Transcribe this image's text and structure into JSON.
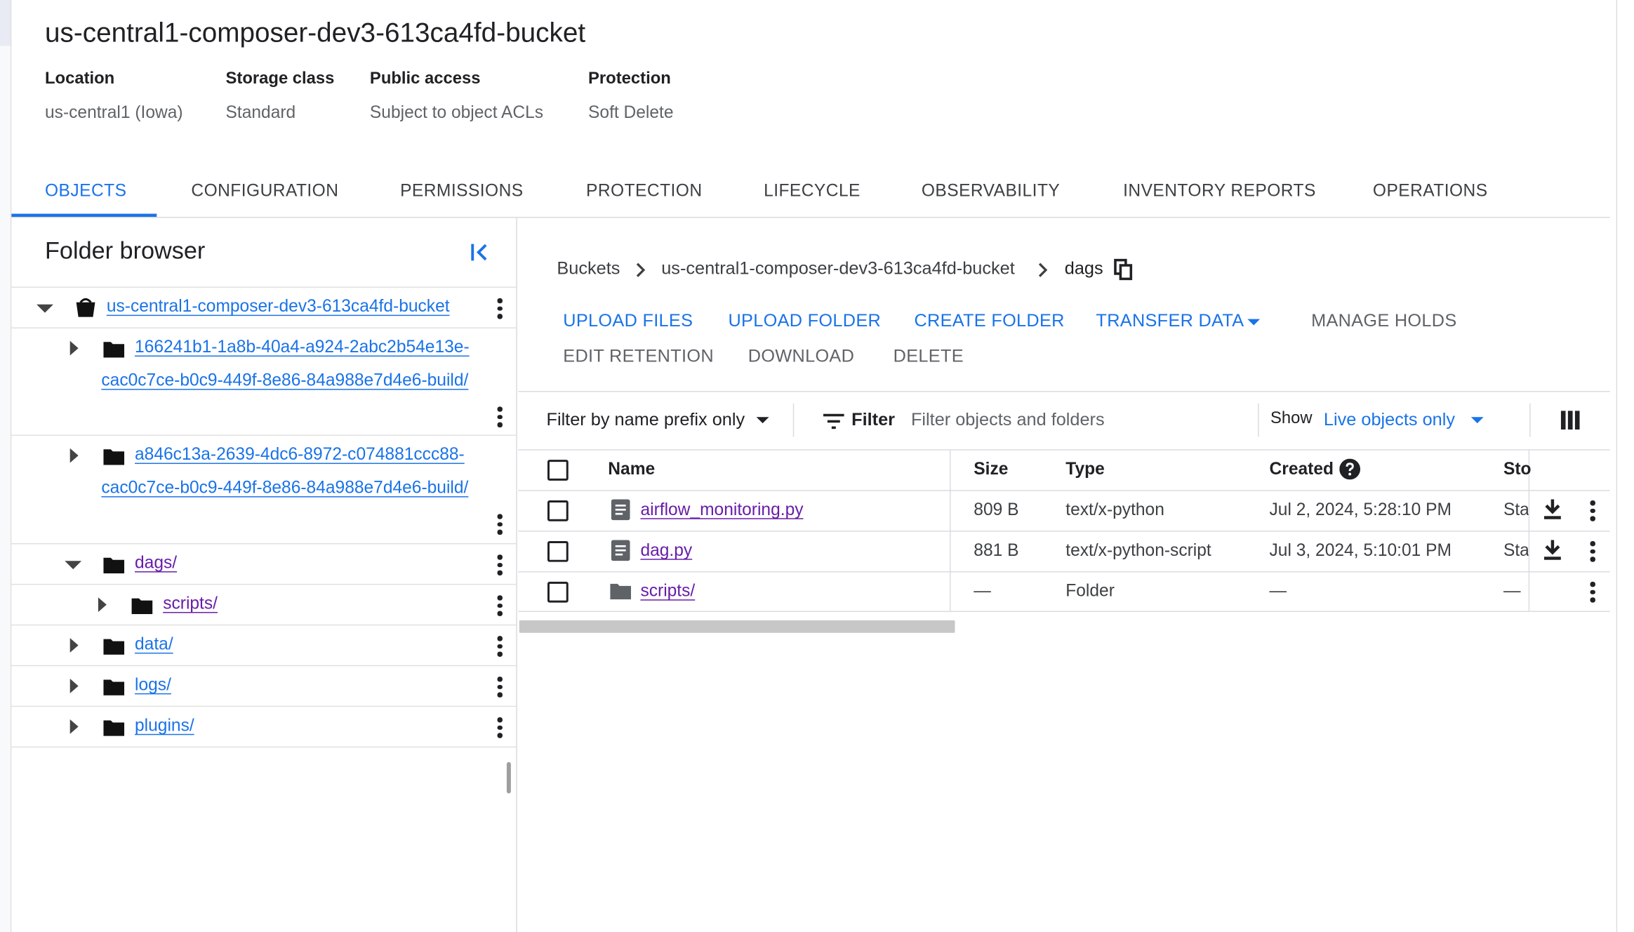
{
  "bucket": {
    "title": "us-central1-composer-dev3-613ca4fd-bucket",
    "meta": [
      {
        "label": "Location",
        "value": "us-central1 (Iowa)"
      },
      {
        "label": "Storage class",
        "value": "Standard"
      },
      {
        "label": "Public access",
        "value": "Subject to object ACLs"
      },
      {
        "label": "Protection",
        "value": "Soft Delete"
      }
    ]
  },
  "tabs": [
    "OBJECTS",
    "CONFIGURATION",
    "PERMISSIONS",
    "PROTECTION",
    "LIFECYCLE",
    "OBSERVABILITY",
    "INVENTORY REPORTS",
    "OPERATIONS"
  ],
  "active_tab": "OBJECTS",
  "folder_browser": {
    "title": "Folder browser",
    "root": "us-central1-composer-dev3-613ca4fd-bucket",
    "items": [
      {
        "line1": "166241b1-1a8b-40a4-a924-2abc2b54e13e-",
        "line2": "cac0c7ce-b0c9-449f-8e86-84a988e7d4e6-build/"
      },
      {
        "line1": "a846c13a-2639-4dc6-8972-c074881ccc88-",
        "line2": "cac0c7ce-b0c9-449f-8e86-84a988e7d4e6-build/"
      },
      {
        "label": "dags/",
        "expanded": true
      },
      {
        "label": "scripts/",
        "child": true
      },
      {
        "label": "data/"
      },
      {
        "label": "logs/"
      },
      {
        "label": "plugins/"
      }
    ]
  },
  "breadcrumb": {
    "items": [
      "Buckets",
      "us-central1-composer-dev3-613ca4fd-bucket"
    ],
    "current": "dags",
    "copy_icon": "copy-icon"
  },
  "actions": {
    "upload_files": "UPLOAD FILES",
    "upload_folder": "UPLOAD FOLDER",
    "create_folder": "CREATE FOLDER",
    "transfer_data": "TRANSFER DATA",
    "manage_holds": "MANAGE HOLDS",
    "edit_retention": "EDIT RETENTION",
    "download": "DOWNLOAD",
    "delete": "DELETE"
  },
  "filter": {
    "mode": "Filter by name prefix only",
    "label": "Filter",
    "placeholder": "Filter objects and folders",
    "show_label": "Show",
    "show_value": "Live objects only"
  },
  "table": {
    "columns": [
      "Name",
      "Size",
      "Type",
      "Created",
      "Sto"
    ],
    "rows": [
      {
        "name": "airflow_monitoring.py",
        "size": "809 B",
        "type": "text/x-python",
        "created": "Jul 2, 2024, 5:28:10 PM",
        "storage": "Sta",
        "kind": "file"
      },
      {
        "name": "dag.py",
        "size": "881 B",
        "type": "text/x-python-script",
        "created": "Jul 3, 2024, 5:10:01 PM",
        "storage": "Sta",
        "kind": "file"
      },
      {
        "name": "scripts/",
        "size": "—",
        "type": "Folder",
        "created": "—",
        "storage": "—",
        "kind": "folder"
      }
    ]
  },
  "colors": {
    "accent": "#1a73e8",
    "visited": "#681da8",
    "border": "#dadce0"
  }
}
